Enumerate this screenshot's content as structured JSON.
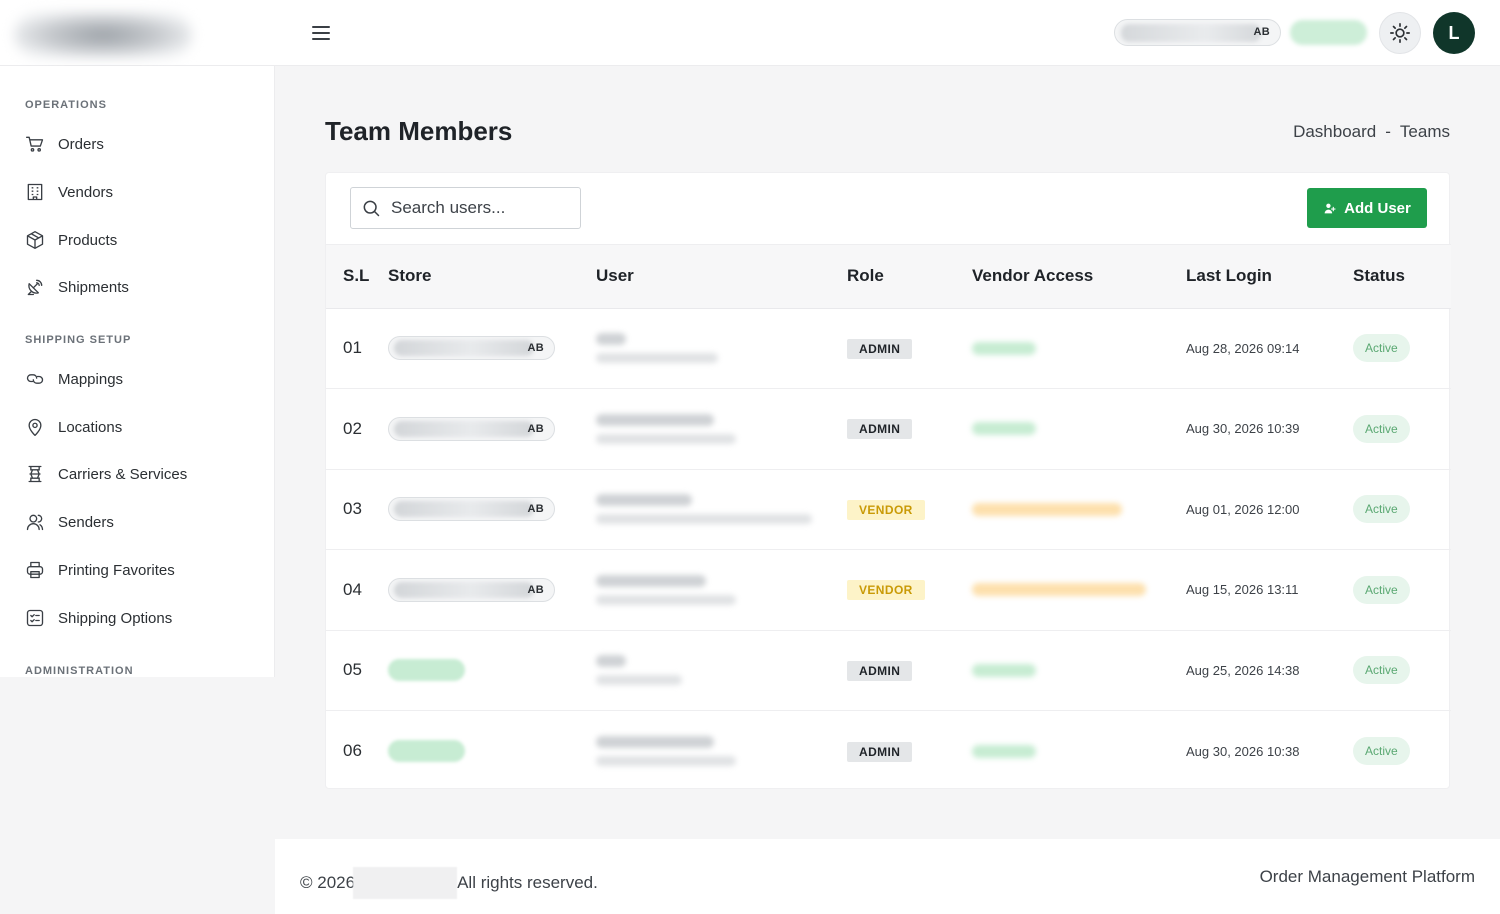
{
  "header": {
    "store_pill_text": "AB",
    "avatar_initial": "L"
  },
  "sidebar": {
    "sections": [
      {
        "title": "OPERATIONS",
        "items": [
          "Orders",
          "Vendors",
          "Products",
          "Shipments"
        ]
      },
      {
        "title": "SHIPPING SETUP",
        "items": [
          "Mappings",
          "Locations",
          "Carriers & Services",
          "Senders",
          "Printing Favorites",
          "Shipping Options"
        ]
      },
      {
        "title": "ADMINISTRATION",
        "items": []
      }
    ]
  },
  "page": {
    "title": "Team Members",
    "breadcrumb": {
      "home": "Dashboard",
      "sep": "-",
      "current": "Teams"
    }
  },
  "toolbar": {
    "search_placeholder": "Search users...",
    "add_user_label": "Add User"
  },
  "table": {
    "headers": [
      "S.L",
      "Store",
      "User",
      "Role",
      "Vendor Access",
      "Last Login",
      "Status"
    ],
    "rows": [
      {
        "sl": "01",
        "store": "AB",
        "role": "ADMIN",
        "last_login": "Aug 28, 2026 09:14",
        "status": "Active"
      },
      {
        "sl": "02",
        "store": "AB",
        "role": "ADMIN",
        "last_login": "Aug 30, 2026 10:39",
        "status": "Active"
      },
      {
        "sl": "03",
        "store": "AB",
        "role": "VENDOR",
        "last_login": "Aug 01, 2026 12:00",
        "status": "Active"
      },
      {
        "sl": "04",
        "store": "AB",
        "role": "VENDOR",
        "last_login": "Aug 15, 2026 13:11",
        "status": "Active"
      },
      {
        "sl": "05",
        "store": "",
        "role": "ADMIN",
        "last_login": "Aug 25, 2026 14:38",
        "status": "Active"
      },
      {
        "sl": "06",
        "store": "",
        "role": "ADMIN",
        "last_login": "Aug 30, 2026 10:38",
        "status": "Active"
      }
    ]
  },
  "footer": {
    "copyright_prefix": "© 2026",
    "rights": "All rights reserved.",
    "platform": "Order Management Platform"
  },
  "colors": {
    "primary": "#1f9d4c",
    "avatar_bg": "#10362a",
    "vendor_badge_text": "#c99a06",
    "status_green": "#5aa872"
  }
}
